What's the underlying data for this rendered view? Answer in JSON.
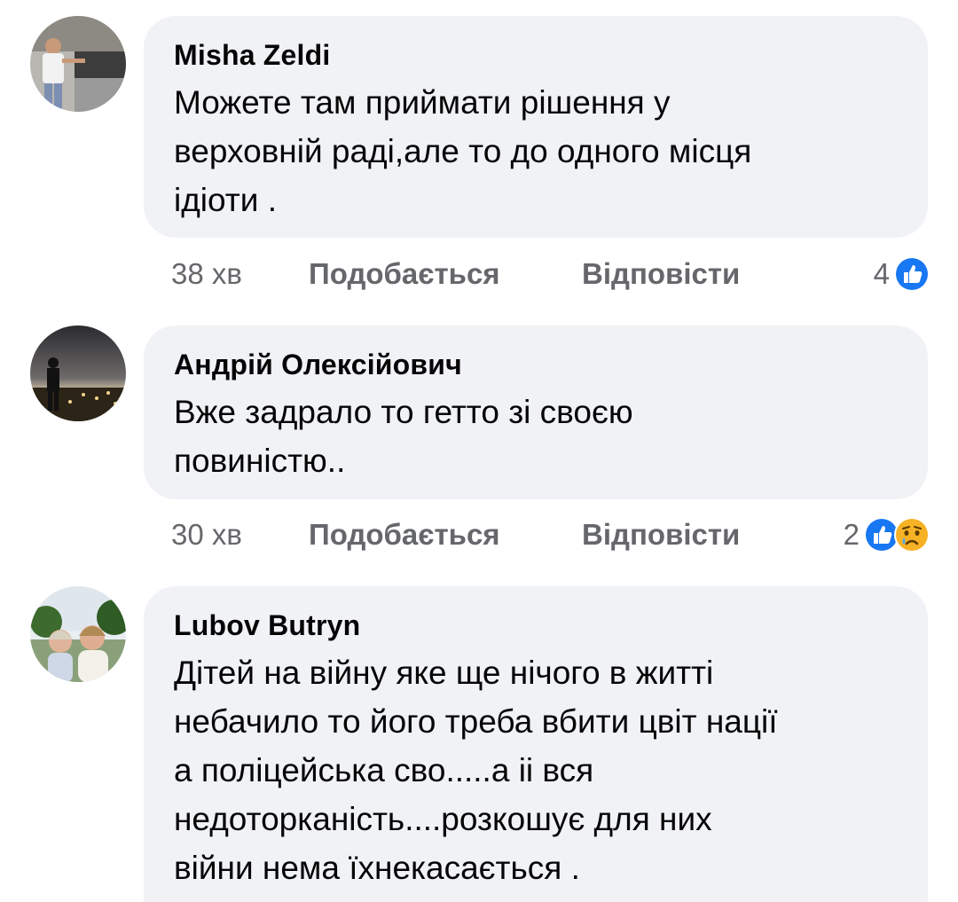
{
  "comments": [
    {
      "author": "Misha Zeldi",
      "text": "Можете там приймати рішення у\nверховній раді,але то до одного місця\nідіоти .",
      "time": "38 хв",
      "like_label": "Подобається",
      "reply_label": "Відповісти",
      "reaction_count": "4",
      "reactions": [
        "like-icon"
      ]
    },
    {
      "author": "Андрій Олексійович",
      "text": "Вже задрало то гетто зі своєю\nповиністю..",
      "time": "30 хв",
      "like_label": "Подобається",
      "reply_label": "Відповісти",
      "reaction_count": "2",
      "reactions": [
        "like-icon",
        "sad-icon"
      ]
    },
    {
      "author": "Lubov Butryn",
      "text": "Дітей на війну яке ще нічого в житті\nнебачило то його треба вбити цвіт нації\nа поліцейська сво.....а іі вся\nнедоторканість....розкошує для них\nвійни нема їхнекасається ."
    }
  ],
  "colors": {
    "bubble": "#f0f2f5",
    "meta_text": "#65676b",
    "like_blue": "#1877f2"
  }
}
